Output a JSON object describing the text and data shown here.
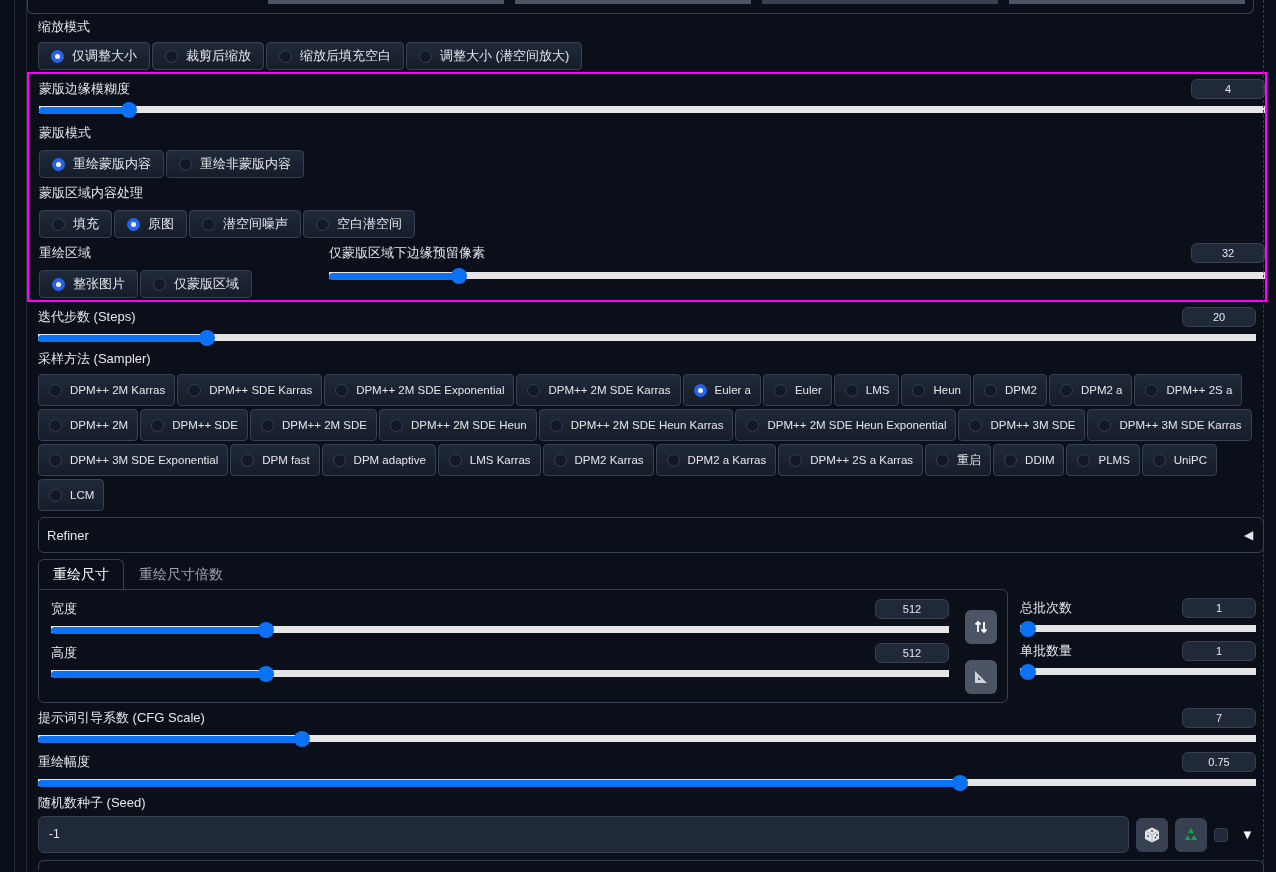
{
  "resize_mode": {
    "label": "缩放模式",
    "options": [
      {
        "label": "仅调整大小",
        "selected": true
      },
      {
        "label": "裁剪后缩放",
        "selected": false
      },
      {
        "label": "缩放后填充空白",
        "selected": false
      },
      {
        "label": "调整大小 (潜空间放大)",
        "selected": false
      }
    ]
  },
  "mask_blur": {
    "label": "蒙版边缘模糊度",
    "value": "4",
    "level": 0.067
  },
  "mask_mode": {
    "label": "蒙版模式",
    "options": [
      {
        "label": "重绘蒙版内容",
        "selected": true
      },
      {
        "label": "重绘非蒙版内容",
        "selected": false
      }
    ]
  },
  "masked_content": {
    "label": "蒙版区域内容处理",
    "options": [
      {
        "label": "填充",
        "selected": false
      },
      {
        "label": "原图",
        "selected": true
      },
      {
        "label": "潜空间噪声",
        "selected": false
      },
      {
        "label": "空白潜空间",
        "selected": false
      }
    ]
  },
  "inpaint_area": {
    "label": "重绘区域",
    "options": [
      {
        "label": "整张图片",
        "selected": true
      },
      {
        "label": "仅蒙版区域",
        "selected": false
      }
    ]
  },
  "only_masked_padding": {
    "label": "仅蒙版区域下边缘预留像素",
    "value": "32",
    "level": 0.13
  },
  "steps": {
    "label": "迭代步数 (Steps)",
    "value": "20",
    "level": 0.132
  },
  "sampler": {
    "label": "采样方法 (Sampler)",
    "options": [
      {
        "label": "DPM++ 2M Karras",
        "selected": false
      },
      {
        "label": "DPM++ SDE Karras",
        "selected": false
      },
      {
        "label": "DPM++ 2M SDE Exponential",
        "selected": false
      },
      {
        "label": "DPM++ 2M SDE Karras",
        "selected": false
      },
      {
        "label": "Euler a",
        "selected": true
      },
      {
        "label": "Euler",
        "selected": false
      },
      {
        "label": "LMS",
        "selected": false
      },
      {
        "label": "Heun",
        "selected": false
      },
      {
        "label": "DPM2",
        "selected": false
      },
      {
        "label": "DPM2 a",
        "selected": false
      },
      {
        "label": "DPM++ 2S a",
        "selected": false
      },
      {
        "label": "DPM++ 2M",
        "selected": false
      },
      {
        "label": "DPM++ SDE",
        "selected": false
      },
      {
        "label": "DPM++ 2M SDE",
        "selected": false
      },
      {
        "label": "DPM++ 2M SDE Heun",
        "selected": false
      },
      {
        "label": "DPM++ 2M SDE Heun Karras",
        "selected": false
      },
      {
        "label": "DPM++ 2M SDE Heun Exponential",
        "selected": false
      },
      {
        "label": "DPM++ 3M SDE",
        "selected": false
      },
      {
        "label": "DPM++ 3M SDE Karras",
        "selected": false
      },
      {
        "label": "DPM++ 3M SDE Exponential",
        "selected": false
      },
      {
        "label": "DPM fast",
        "selected": false
      },
      {
        "label": "DPM adaptive",
        "selected": false
      },
      {
        "label": "LMS Karras",
        "selected": false
      },
      {
        "label": "DPM2 Karras",
        "selected": false
      },
      {
        "label": "DPM2 a Karras",
        "selected": false
      },
      {
        "label": "DPM++ 2S a Karras",
        "selected": false
      },
      {
        "label": "重启",
        "selected": false
      },
      {
        "label": "DDIM",
        "selected": false
      },
      {
        "label": "PLMS",
        "selected": false
      },
      {
        "label": "UniPC",
        "selected": false
      },
      {
        "label": "LCM",
        "selected": false
      }
    ]
  },
  "refiner": {
    "label": "Refiner",
    "toggle": "◀"
  },
  "size_tabs": [
    {
      "label": "重绘尺寸",
      "selected": true
    },
    {
      "label": "重绘尺寸倍数",
      "selected": false
    }
  ],
  "width": {
    "label": "宽度",
    "value": "512",
    "level": 0.23
  },
  "height": {
    "label": "高度",
    "value": "512",
    "level": 0.23
  },
  "batch_count": {
    "label": "总批次数",
    "value": "1",
    "level": 0
  },
  "batch_size": {
    "label": "单批数量",
    "value": "1",
    "level": 0
  },
  "cfg_scale": {
    "label": "提示词引导系数 (CFG Scale)",
    "value": "7",
    "level": 0.21
  },
  "denoising": {
    "label": "重绘幅度",
    "value": "0.75",
    "level": 0.75
  },
  "seed": {
    "label": "随机数种子 (Seed)",
    "value": "-1",
    "extra_checked": false,
    "toggle": "▼"
  }
}
